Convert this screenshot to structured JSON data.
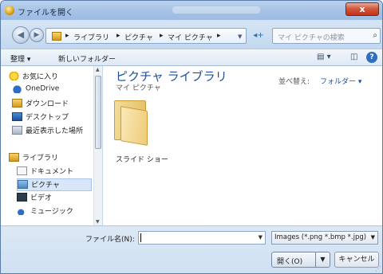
{
  "window": {
    "title": "ファイルを開く",
    "close_label": "x"
  },
  "address": {
    "crumbs": [
      "ライブラリ",
      "ピクチャ",
      "マイ ピクチャ"
    ],
    "separator": "▸",
    "search_placeholder": "マイ ピクチャの検索"
  },
  "toolbar": {
    "organize": "整理 ▾",
    "new_folder": "新しいフォルダー"
  },
  "nav": {
    "items": [
      {
        "label": "お気に入り",
        "icon": "star-icon"
      },
      {
        "label": "OneDrive",
        "icon": "cloud-icon"
      },
      {
        "label": "ダウンロード",
        "icon": "download-folder-icon"
      },
      {
        "label": "デスクトップ",
        "icon": "desktop-icon"
      },
      {
        "label": "最近表示した場所",
        "icon": "recent-places-icon"
      },
      {
        "label": "ライブラリ",
        "icon": "library-icon"
      },
      {
        "label": "ドキュメント",
        "icon": "documents-icon"
      },
      {
        "label": "ピクチャ",
        "icon": "pictures-icon"
      },
      {
        "label": "ビデオ",
        "icon": "videos-icon"
      },
      {
        "label": "ミュージック",
        "icon": "music-icon"
      }
    ]
  },
  "main": {
    "library_title": "ピクチャ ライブラリ",
    "library_subtitle": "マイ ピクチャ",
    "sort_label": "並べ替え:",
    "sort_value": "フォルダー ▾",
    "items": [
      {
        "label": "スライド ショー",
        "icon": "folder-icon"
      }
    ]
  },
  "bottom": {
    "filename_label": "ファイル名(N):",
    "filename_value": "",
    "filter_value": "Images (*.png *.bmp *.jpg)",
    "open_label": "開く(O)",
    "cancel_label": "キャンセル"
  },
  "colors": {
    "accent": "#1f4f9a",
    "close": "#c9432a",
    "selection": "#d7e6f8"
  }
}
